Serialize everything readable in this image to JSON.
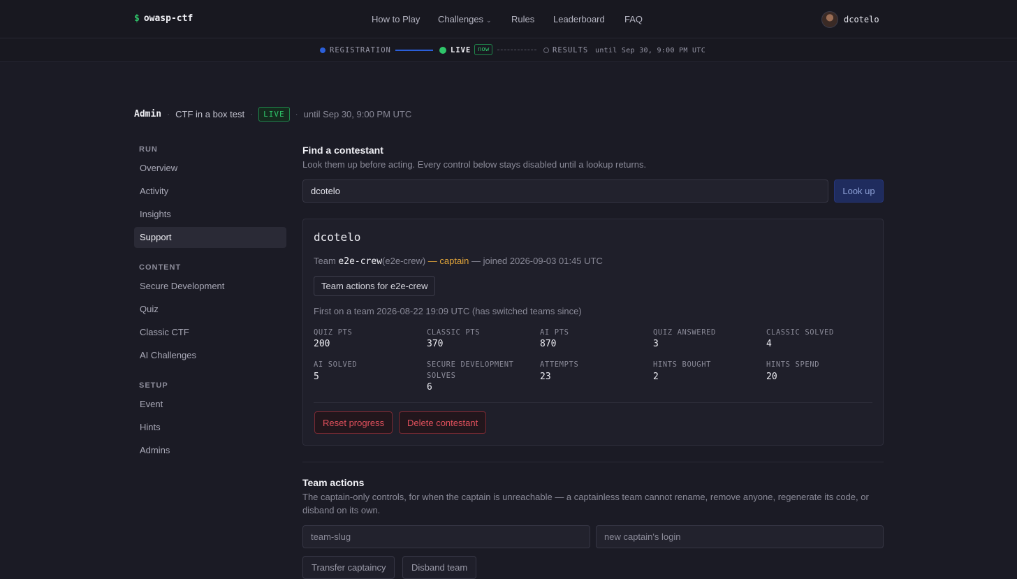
{
  "brand": {
    "prefix": "$",
    "name": "owasp-ctf"
  },
  "nav": {
    "links": [
      "How to Play",
      "Challenges",
      "Rules",
      "Leaderboard",
      "FAQ"
    ],
    "challenges_chevron": "⌄"
  },
  "user": {
    "login": "dcotelo",
    "avatar_icon": "avatar-photo"
  },
  "phases": {
    "registration": "REGISTRATION",
    "live": "LIVE",
    "now": "now",
    "results": "RESULTS",
    "until": "until Sep 30, 9:00 PM UTC"
  },
  "colors": {
    "accent_green": "#2fc56a",
    "accent_blue": "#2b5fd9",
    "captain": "#e0a43a",
    "danger": "#e0505c"
  },
  "breadcrumb": {
    "section": "Admin",
    "event": "CTF in a box test",
    "status": "LIVE",
    "until": "until Sep 30, 9:00 PM UTC"
  },
  "sidebar": {
    "run": {
      "heading": "RUN",
      "items": [
        "Overview",
        "Activity",
        "Insights",
        "Support"
      ]
    },
    "content": {
      "heading": "CONTENT",
      "items": [
        "Secure Development",
        "Quiz",
        "Classic CTF",
        "AI Challenges"
      ]
    },
    "setup": {
      "heading": "SETUP",
      "items": [
        "Event",
        "Hints",
        "Admins"
      ]
    },
    "active": "Support"
  },
  "find": {
    "title": "Find a contestant",
    "description": "Look them up before acting. Every control below stays disabled until a lookup returns.",
    "input_value": "dcotelo",
    "button": "Look up"
  },
  "contestant": {
    "login": "dcotelo",
    "team_prefix": "Team",
    "team_name": "e2e-crew",
    "team_slug": "(e2e-crew)",
    "role": "— captain",
    "joined": "— joined 2026-09-03 01:45 UTC",
    "team_actions_button": "Team actions for e2e-crew",
    "first_on_team": "First on a team 2026-08-22 19:09 UTC (has switched teams since)",
    "stats": [
      {
        "label": "QUIZ PTS",
        "value": "200"
      },
      {
        "label": "CLASSIC PTS",
        "value": "370"
      },
      {
        "label": "AI PTS",
        "value": "870"
      },
      {
        "label": "QUIZ ANSWERED",
        "value": "3"
      },
      {
        "label": "CLASSIC SOLVED",
        "value": "4"
      },
      {
        "label": "AI SOLVED",
        "value": "5"
      },
      {
        "label": "SECURE DEVELOPMENT SOLVES",
        "value": "6"
      },
      {
        "label": "ATTEMPTS",
        "value": "23"
      },
      {
        "label": "HINTS BOUGHT",
        "value": "2"
      },
      {
        "label": "HINTS SPEND",
        "value": "20"
      }
    ],
    "reset_button": "Reset progress",
    "delete_button": "Delete contestant"
  },
  "team_actions": {
    "title": "Team actions",
    "description": "The captain-only controls, for when the captain is unreachable — a captainless team cannot rename, remove anyone, regenerate its code, or disband on its own.",
    "slug_placeholder": "team-slug",
    "captain_placeholder": "new captain's login",
    "transfer_button": "Transfer captaincy",
    "disband_button": "Disband team"
  }
}
